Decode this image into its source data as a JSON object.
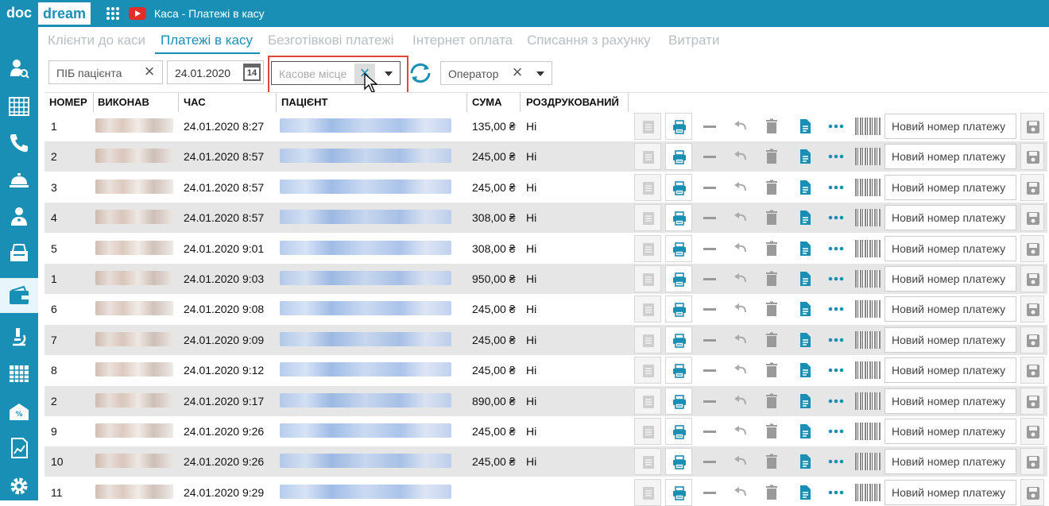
{
  "app": {
    "logo_left": "doc",
    "logo_right": "dream",
    "title": "Каса - Платежі в касу"
  },
  "tabs": [
    {
      "label": "Клієнти до каси",
      "active": false
    },
    {
      "label": "Платежі в касу",
      "active": true
    },
    {
      "label": "Безготівкові платежі",
      "active": false
    },
    {
      "label": "Інтернет оплата",
      "active": false
    },
    {
      "label": "Списання з рахунку",
      "active": false
    },
    {
      "label": "Витрати",
      "active": false
    }
  ],
  "filters": {
    "patient_placeholder": "ПІБ пацієнта",
    "date_value": "24.01.2020",
    "calendar_day": "14",
    "cash_desk_placeholder": "Касове місце",
    "operator_placeholder": "Оператор"
  },
  "table": {
    "columns": [
      "НОМЕР",
      "ВИКОНАВ",
      "ЧАС",
      "ПАЦІЄНТ",
      "СУМА",
      "РОЗДРУКОВАНИЙ"
    ],
    "rows": [
      {
        "number": "1",
        "time": "24.01.2020 8:27",
        "sum": "135,00 ₴",
        "printed": "Ні"
      },
      {
        "number": "2",
        "time": "24.01.2020 8:57",
        "sum": "245,00 ₴",
        "printed": "Ні"
      },
      {
        "number": "3",
        "time": "24.01.2020 8:57",
        "sum": "245,00 ₴",
        "printed": "Ні"
      },
      {
        "number": "4",
        "time": "24.01.2020 8:57",
        "sum": "308,00 ₴",
        "printed": "Ні"
      },
      {
        "number": "5",
        "time": "24.01.2020 9:01",
        "sum": "308,00 ₴",
        "printed": "Ні"
      },
      {
        "number": "1",
        "time": "24.01.2020 9:03",
        "sum": "950,00 ₴",
        "printed": "Ні"
      },
      {
        "number": "6",
        "time": "24.01.2020 9:08",
        "sum": "245,00 ₴",
        "printed": "Ні"
      },
      {
        "number": "7",
        "time": "24.01.2020 9:09",
        "sum": "245,00 ₴",
        "printed": "Ні"
      },
      {
        "number": "8",
        "time": "24.01.2020 9:12",
        "sum": "245,00 ₴",
        "printed": "Ні"
      },
      {
        "number": "2",
        "time": "24.01.2020 9:17",
        "sum": "890,00 ₴",
        "printed": "Ні"
      },
      {
        "number": "9",
        "time": "24.01.2020 9:26",
        "sum": "245,00 ₴",
        "printed": "Ні"
      },
      {
        "number": "10",
        "time": "24.01.2020 9:26",
        "sum": "245,00 ₴",
        "printed": "Ні"
      },
      {
        "number": "11",
        "time": "24.01.2020 9:29",
        "sum": "",
        "printed": ""
      }
    ],
    "new_number_placeholder": "Новий номер платежу"
  },
  "icons": {
    "sidebar": [
      "user-search-icon",
      "grid-table-icon",
      "phone-icon",
      "reception-bell-icon",
      "doctor-icon",
      "cash-register-icon",
      "wallet-icon",
      "microscope-icon",
      "calendar-grid-icon",
      "discount-envelope-icon",
      "report-chart-icon",
      "settings-gear-icon"
    ],
    "row_actions": [
      "document-icon",
      "print-icon",
      "minus-icon",
      "undo-icon",
      "trash-icon",
      "file-icon",
      "more-icon",
      "barcode-icon",
      "save-icon"
    ]
  },
  "colors": {
    "brand": "#1a8fb5",
    "highlight": "#e0463c",
    "row_alt": "#e6e6e6"
  }
}
